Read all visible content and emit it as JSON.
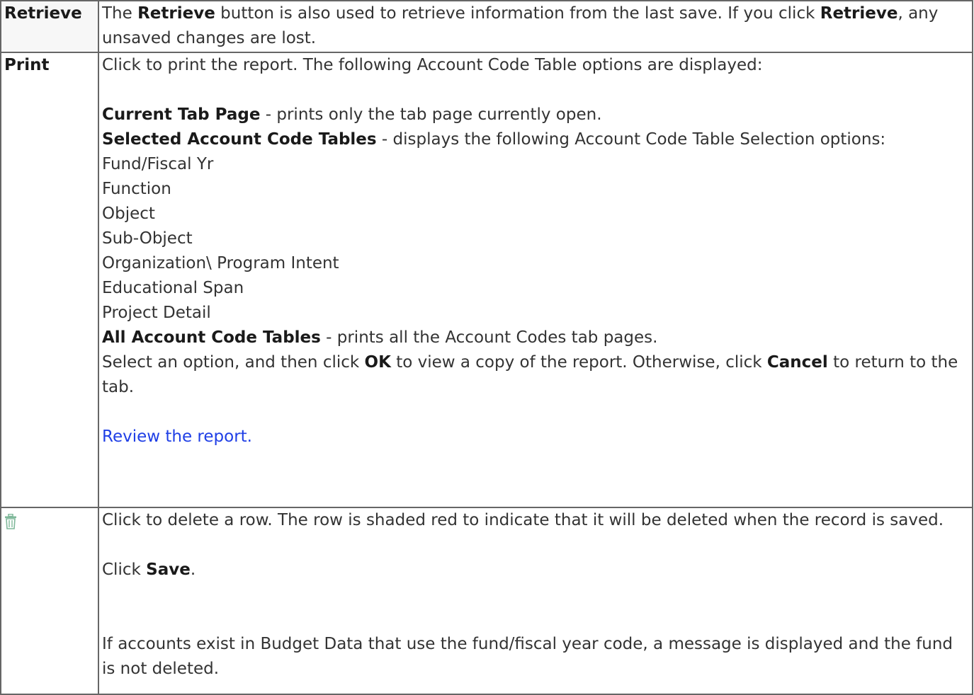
{
  "rows": {
    "retrieve": {
      "term": "Retrieve",
      "d1": "The ",
      "d2": "Retrieve",
      "d3": " button is also used to retrieve information from the last save. If you click ",
      "d4": "Retrieve",
      "d5": ", any unsaved changes are lost."
    },
    "print": {
      "term": "Print",
      "intro": "Click to print the report. The following Account Code Table options are displayed:",
      "opt1_bold": "Current Tab Page",
      "opt1_text": " - prints only the tab page currently open.",
      "opt2_bold": "Selected Account Code Tables",
      "opt2_text": " - displays the following Account Code Table Selection options:",
      "tables": [
        "Fund/Fiscal Yr",
        "Function",
        "Object",
        "Sub-Object",
        "Organization\\ Program Intent",
        "Educational Span",
        "Project Detail"
      ],
      "opt3_bold": "All Account Code Tables",
      "opt3_text": " - prints all the Account Codes tab pages.",
      "sel1": "Select an option, and then click ",
      "sel_ok": "OK",
      "sel2": " to view a copy of the report. Otherwise, click ",
      "sel_cancel": "Cancel",
      "sel3": " to return to the tab.",
      "review_link": "Review the report."
    },
    "delete": {
      "icon": "trash-icon",
      "icon_color": "#7fb89a",
      "text1": "Click to delete a row. The row is shaded red to indicate that it will be deleted when the record is saved.",
      "save1": "Click ",
      "save_bold": "Save",
      "save2": ".",
      "message": "If accounts exist in Budget Data that use the fund/fiscal year code, a message is displayed and the fund is not deleted."
    }
  }
}
